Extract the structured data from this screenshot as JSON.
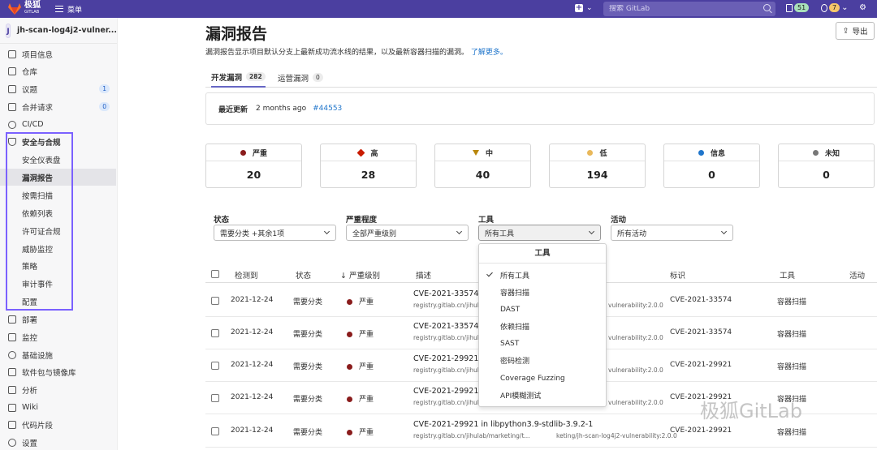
{
  "topbar": {
    "logo_text": "极狐",
    "logo_sub": "GITLAB",
    "menu_label": "菜单",
    "search_placeholder": "搜索 GitLab",
    "mr_count": "51",
    "todo_count": "7"
  },
  "sidebar": {
    "project_avatar": "J",
    "project_name": "jh-scan-log4j2-vulner...",
    "items": [
      {
        "label": "项目信息"
      },
      {
        "label": "仓库"
      },
      {
        "label": "议题",
        "badge": "1"
      },
      {
        "label": "合并请求",
        "badge": "0"
      },
      {
        "label": "CI/CD"
      },
      {
        "label": "安全与合规"
      }
    ],
    "sub_items": [
      {
        "label": "安全仪表盘"
      },
      {
        "label": "漏洞报告"
      },
      {
        "label": "按需扫描"
      },
      {
        "label": "依赖列表"
      },
      {
        "label": "许可证合规"
      },
      {
        "label": "威胁监控"
      },
      {
        "label": "策略"
      },
      {
        "label": "审计事件"
      },
      {
        "label": "配置"
      }
    ],
    "bottom_items": [
      {
        "label": "部署"
      },
      {
        "label": "监控"
      },
      {
        "label": "基础设施"
      },
      {
        "label": "软件包与镜像库"
      },
      {
        "label": "分析"
      },
      {
        "label": "Wiki"
      },
      {
        "label": "代码片段"
      },
      {
        "label": "设置"
      }
    ]
  },
  "main": {
    "title": "漏洞报告",
    "export_label": "导出",
    "description": "漏洞报告显示项目默认分支上最新成功流水线的结果，以及最新容器扫描的漏洞。",
    "learn_more": "了解更多。",
    "tabs": [
      {
        "label": "开发漏洞",
        "count": "282"
      },
      {
        "label": "运营漏洞",
        "count": "0"
      }
    ],
    "last_updated_label": "最近更新",
    "last_updated_value": "2 months ago",
    "pipeline_link": "#44553",
    "severity_cards": [
      {
        "label": "严重",
        "count": "20",
        "color": "#8a1c1c"
      },
      {
        "label": "高",
        "count": "28",
        "color": "#c91c00"
      },
      {
        "label": "中",
        "count": "40",
        "color": "#b8860b"
      },
      {
        "label": "低",
        "count": "194",
        "color": "#e9b85a"
      },
      {
        "label": "信息",
        "count": "0",
        "color": "#1f75cb"
      },
      {
        "label": "未知",
        "count": "0",
        "color": "#777777"
      }
    ],
    "filters": [
      {
        "label": "状态",
        "value": "需要分类 +其余1项"
      },
      {
        "label": "严重程度",
        "value": "全部严重级别"
      },
      {
        "label": "工具",
        "value": "所有工具"
      },
      {
        "label": "活动",
        "value": "所有活动"
      }
    ],
    "table_headers": {
      "detected": "检测到",
      "status": "状态",
      "severity": "↓ 严重级别",
      "description": "描述",
      "identifier": "标识",
      "tool": "工具",
      "activity": "活动"
    },
    "rows": [
      {
        "date": "2021-12-24",
        "status": "需要分类",
        "severity": "严重",
        "title": "CVE-2021-33574 i",
        "sub": "registry.gitlab.cn/jihul",
        "sub_right": "vulnerability:2.0.0",
        "identifier": "CVE-2021-33574",
        "tool": "容器扫描"
      },
      {
        "date": "2021-12-24",
        "status": "需要分类",
        "severity": "严重",
        "title": "CVE-2021-33574 i",
        "sub": "registry.gitlab.cn/jihul",
        "sub_right": "vulnerability:2.0.0",
        "identifier": "CVE-2021-33574",
        "tool": "容器扫描"
      },
      {
        "date": "2021-12-24",
        "status": "需要分类",
        "severity": "严重",
        "title": "CVE-2021-29921 i",
        "sub": "registry.gitlab.cn/jihul",
        "sub_right": "vulnerability:2.0.0",
        "identifier": "CVE-2021-29921",
        "tool": "容器扫描"
      },
      {
        "date": "2021-12-24",
        "status": "需要分类",
        "severity": "严重",
        "title": "CVE-2021-29921 i",
        "sub": "registry.gitlab.cn/jihul",
        "sub_right": "vulnerability:2.0.0",
        "identifier": "CVE-2021-29921",
        "tool": "容器扫描"
      },
      {
        "date": "2021-12-24",
        "status": "需要分类",
        "severity": "严重",
        "title": "CVE-2021-29921 in libpython3.9-stdlib-3.9.2-1",
        "sub": "registry.gitlab.cn/jihulab/marketing/t...",
        "sub_right": "keting/jh-scan-log4j2-vulnerability:2.0.0",
        "identifier": "CVE-2021-29921",
        "tool": "容器扫描"
      }
    ]
  },
  "dropdown": {
    "header": "工具",
    "items": [
      "所有工具",
      "容器扫描",
      "DAST",
      "依赖扫描",
      "SAST",
      "密码检测",
      "Coverage Fuzzing",
      "API模糊测试"
    ]
  },
  "watermark": "极狐GitLab"
}
